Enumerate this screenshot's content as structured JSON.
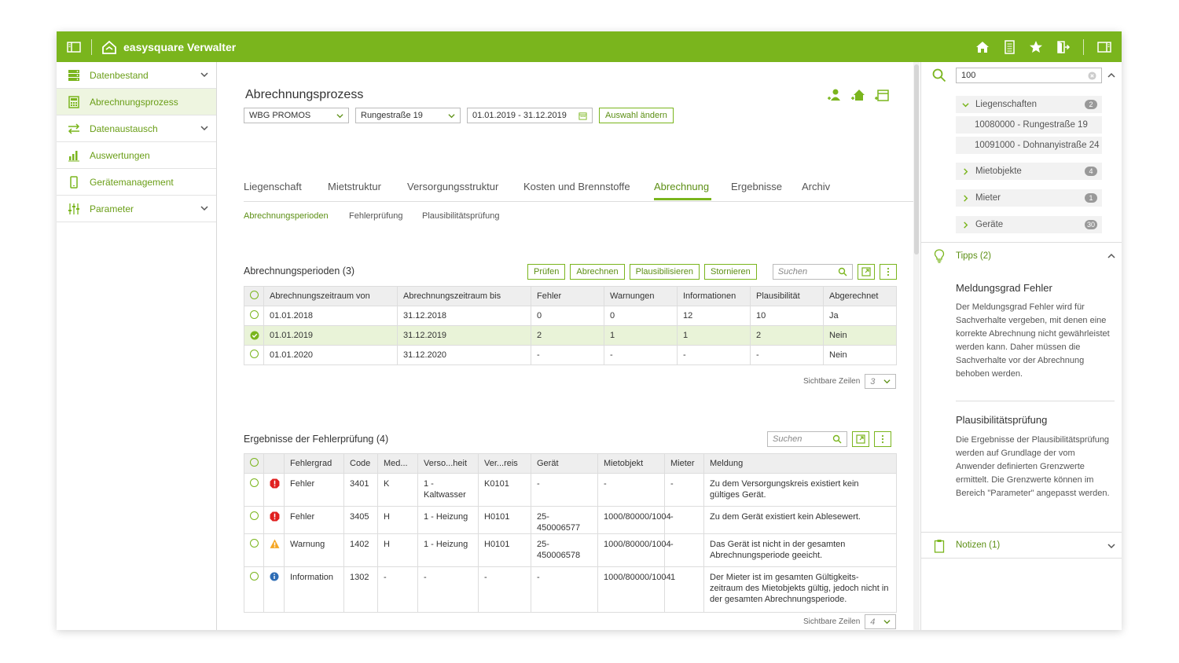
{
  "app": {
    "title": "easysquare Verwalter"
  },
  "sidebar": {
    "items": [
      {
        "label": "Datenbestand",
        "icon": "database-icon",
        "expandable": true
      },
      {
        "label": "Abrechnungsprozess",
        "icon": "calculator-icon",
        "expandable": false,
        "active": true
      },
      {
        "label": "Datenaustausch",
        "icon": "exchange-icon",
        "expandable": true
      },
      {
        "label": "Auswertungen",
        "icon": "bar-chart-icon",
        "expandable": false
      },
      {
        "label": "Gerätemanagement",
        "icon": "mobile-device-icon",
        "expandable": false
      },
      {
        "label": "Parameter",
        "icon": "sliders-icon",
        "expandable": true
      }
    ]
  },
  "header": {
    "title": "Abrechnungsprozess",
    "filters": {
      "company": "WBG PROMOS",
      "property": "Rungestraße 19",
      "period": "01.01.2019 - 31.12.2019",
      "change_button": "Auswahl ändern"
    }
  },
  "tabs": [
    "Liegenschaft",
    "Mietstruktur",
    "Versorgungsstruktur",
    "Kosten und Brennstoffe",
    "Abrechnung",
    "Ergebnisse",
    "Archiv"
  ],
  "subtabs": [
    "Abrechnungsperioden",
    "Fehlerprüfung",
    "Plausibilitätsprüfung"
  ],
  "periods": {
    "title": "Abrechnungsperioden (3)",
    "actions": [
      "Prüfen",
      "Abrechnen",
      "Plausibilisieren",
      "Stornieren"
    ],
    "search_placeholder": "Suchen",
    "columns": [
      "Abrechnungszeitraum von",
      "Abrechnungszeitraum bis",
      "Fehler",
      "Warnungen",
      "Informationen",
      "Plausibilität",
      "Abgerechnet"
    ],
    "rows": [
      [
        "01.01.2018",
        "31.12.2018",
        "0",
        "0",
        "12",
        "10",
        "Ja"
      ],
      [
        "01.01.2019",
        "31.12.2019",
        "2",
        "1",
        "1",
        "2",
        "Nein"
      ],
      [
        "01.01.2020",
        "31.12.2020",
        "-",
        "-",
        "-",
        "-",
        "Nein"
      ]
    ],
    "selected_row": 1,
    "visible_rows_label": "Sichtbare Zeilen",
    "visible_rows_value": "3"
  },
  "errors": {
    "title": "Ergebnisse der Fehlerprüfung (4)",
    "search_placeholder": "Suchen",
    "columns": [
      "Fehlergrad",
      "Code",
      "Med...",
      "Verso...heit",
      "Ver...reis",
      "Gerät",
      "Mietobjekt",
      "Mieter",
      "Meldung"
    ],
    "rows": [
      {
        "severity": "error",
        "grad": "Fehler",
        "code": "3401",
        "med": "K",
        "verso": "1 - Kaltwasser",
        "verreis": "K0101",
        "geraet": "-",
        "mietobjekt": "-",
        "mieter": "-",
        "meldung": "Zu dem Versorgungskreis existiert kein gültiges Gerät."
      },
      {
        "severity": "error",
        "grad": "Fehler",
        "code": "3405",
        "med": "H",
        "verso": "1 - Heizung",
        "verreis": "H0101",
        "geraet": "25-450006577",
        "mietobjekt": "1000/80000/1004",
        "mieter": "-",
        "meldung": "Zu dem Gerät existiert kein Ablesewert."
      },
      {
        "severity": "warning",
        "grad": "Warnung",
        "code": "1402",
        "med": "H",
        "verso": "1 - Heizung",
        "verreis": "H0101",
        "geraet": "25-450006578",
        "mietobjekt": "1000/80000/1004",
        "mieter": "-",
        "meldung": "Das Gerät ist nicht in der gesamten Abrechnungsperiode geeicht."
      },
      {
        "severity": "info",
        "grad": "Information",
        "code": "1302",
        "med": "-",
        "verso": "-",
        "verreis": "-",
        "geraet": "-",
        "mietobjekt": "1000/80000/1004",
        "mieter": "1",
        "meldung": "Der Mieter ist im gesamten Gültigkeits-zeitraum des Mietobjekts gültig, jedoch nicht in der gesamten Abrechnungsperiode."
      }
    ],
    "visible_rows_label": "Sichtbare Zeilen",
    "visible_rows_value": "4"
  },
  "right_panel": {
    "search_value": "100",
    "tree": {
      "liegenschaften": {
        "label": "Liegenschaften",
        "count": "2",
        "children": [
          "10080000 - Rungestraße 19",
          "10091000 - Dohnanyistraße 24"
        ]
      },
      "mietobjekte": {
        "label": "Mietobjekte",
        "count": "4"
      },
      "mieter": {
        "label": "Mieter",
        "count": "1"
      },
      "geraete": {
        "label": "Geräte",
        "count": "30"
      }
    },
    "tips": {
      "header": "Tipps (2)",
      "items": [
        {
          "title": "Meldungsgrad Fehler",
          "text": "Der Meldungsgrad Fehler wird für Sachverhalte vergeben, mit denen eine korrekte Abrechnung nicht gewährleistet werden kann. Daher müssen die Sachverhalte vor der Abrechnung behoben werden."
        },
        {
          "title": "Plausibilitätsprüfung",
          "text": "Die Ergebnisse der Plausibilitätsprüfung werden auf Grundlage der vom Anwender definierten Grenzwerte ermittelt. Die Grenzwerte können im Bereich \"Parameter\" angepasst werden."
        }
      ]
    },
    "notes": {
      "header": "Notizen (1)"
    }
  },
  "colors": {
    "brand": "#7ab51d",
    "brand_dark": "#5c8f14",
    "error": "#e02020",
    "warning": "#f5a623",
    "info": "#2f6db5"
  }
}
